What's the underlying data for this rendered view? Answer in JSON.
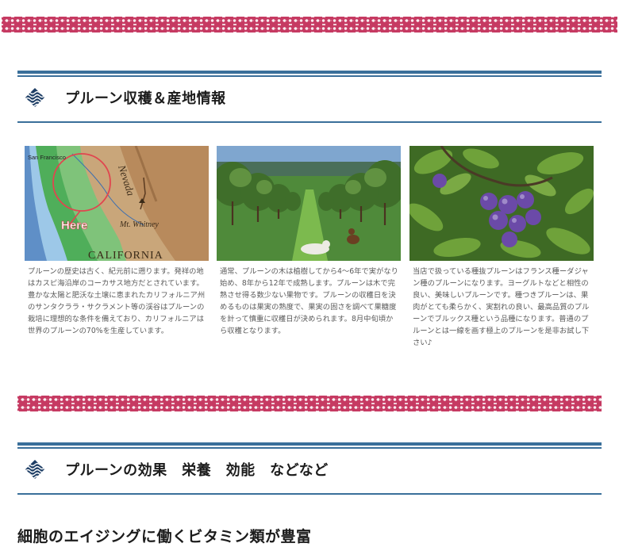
{
  "harvest_section": {
    "title": "プルーン収穫＆産地情報",
    "icon": "wave-diamond-icon"
  },
  "cards": [
    {
      "image": "california-map",
      "map_labels": {
        "city": "San Francisco",
        "range": "Nevada",
        "peak": "Mt. Whitney",
        "marker": "Here",
        "state": "CALIFORNIA"
      },
      "text": "プルーンの歴史は古く、紀元前に遡ります。発祥の地はカスピ海沿岸のコーカサス地方だとされています。豊かな太陽と肥沃な土壌に恵まれたカリフォルニア州のサンタクララ・サクラメント等の渓谷はプルーンの栽培に理想的な条件を備えており、カリフォルニアは世界のプルーンの70%を生産しています。"
    },
    {
      "image": "prune-orchard",
      "text": "通常、プルーンの木は植樹してから4〜6年で実がなり始め、8年から12年で成熟します。プルーンは木で完熟させ得る数少ない果物です。プルーンの収穫日を決めるものは果実の熟度で、果実の固さを調べて果糖度を計って慎重に収穫日が決められます。8月中旬頃から収穫となります。"
    },
    {
      "image": "prunes-on-tree",
      "text": "当店で扱っている種抜プルーンはフランス種ーダジャン種のプルーンになります。ヨーグルトなどと相性の良い、美味しいプルーンです。種つきプルーンは、果肉がとても柔らかく、実割れの良い、最高品質のプルーンでブルックス種という品種になります。普通のプルーンとは一線を画す極上のプルーンを是非お試し下さい♪"
    }
  ],
  "effect_section": {
    "title": "プルーンの効果　栄養　効能　などなど",
    "icon": "wave-diamond-icon"
  },
  "sub_heading": "細胞のエイジングに働くビタミン類が豊富",
  "colors": {
    "accent_blue": "#3a6f9a",
    "pattern_pink": "#c63a62",
    "body_text": "#5a5a5a"
  }
}
